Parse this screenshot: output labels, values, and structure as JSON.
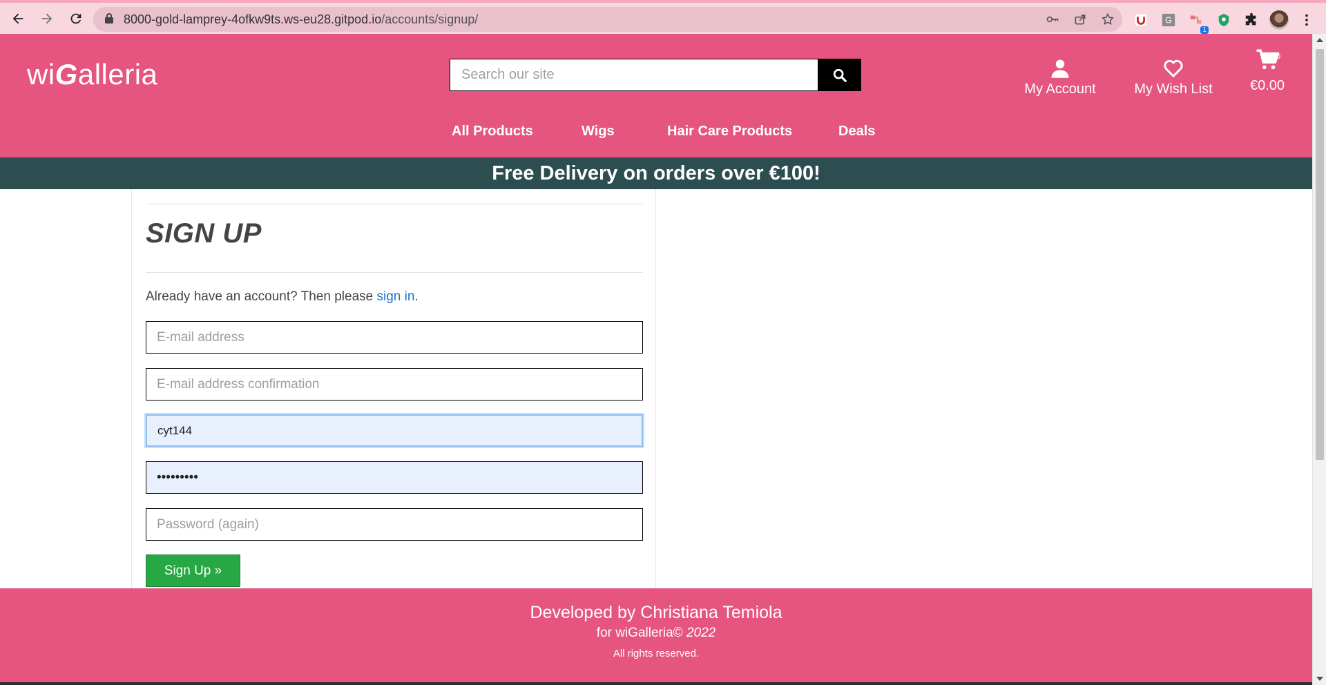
{
  "browser": {
    "url_host": "8000-gold-lamprey-4ofkw9ts.ws-eu28.gitpod.io",
    "url_path": "/accounts/signup/",
    "extension_badge": "1"
  },
  "header": {
    "logo_prefix": "wi",
    "logo_g": "G",
    "logo_suffix": "alleria",
    "search_placeholder": "Search our site",
    "account_label": "My Account",
    "wishlist_label": "My Wish List",
    "cart_total": "€0.00",
    "cart_count": "0"
  },
  "nav": {
    "all_products": "All Products",
    "wigs": "Wigs",
    "hair_care": "Hair Care Products",
    "deals": "Deals"
  },
  "banner": {
    "text": "Free Delivery on orders over €100!"
  },
  "signup": {
    "title": "SIGN UP",
    "intro_prefix": "Already have an account? Then please ",
    "intro_link": "sign in",
    "intro_suffix": ".",
    "email_placeholder": "E-mail address",
    "email_confirm_placeholder": "E-mail address confirmation",
    "username_value": "cyt144",
    "password_value": "•••••••••",
    "password_again_placeholder": "Password (again)",
    "submit_label": "Sign Up »"
  },
  "footer": {
    "developed_by": "Developed by Christiana Temiola",
    "for_text": "for wiGalleria© ",
    "year": "2022",
    "rights": "All rights reserved."
  },
  "colors": {
    "brand_pink": "#e5557f",
    "banner_teal": "#2d4e50",
    "button_green": "#28a745",
    "link_blue": "#1a74c9"
  }
}
